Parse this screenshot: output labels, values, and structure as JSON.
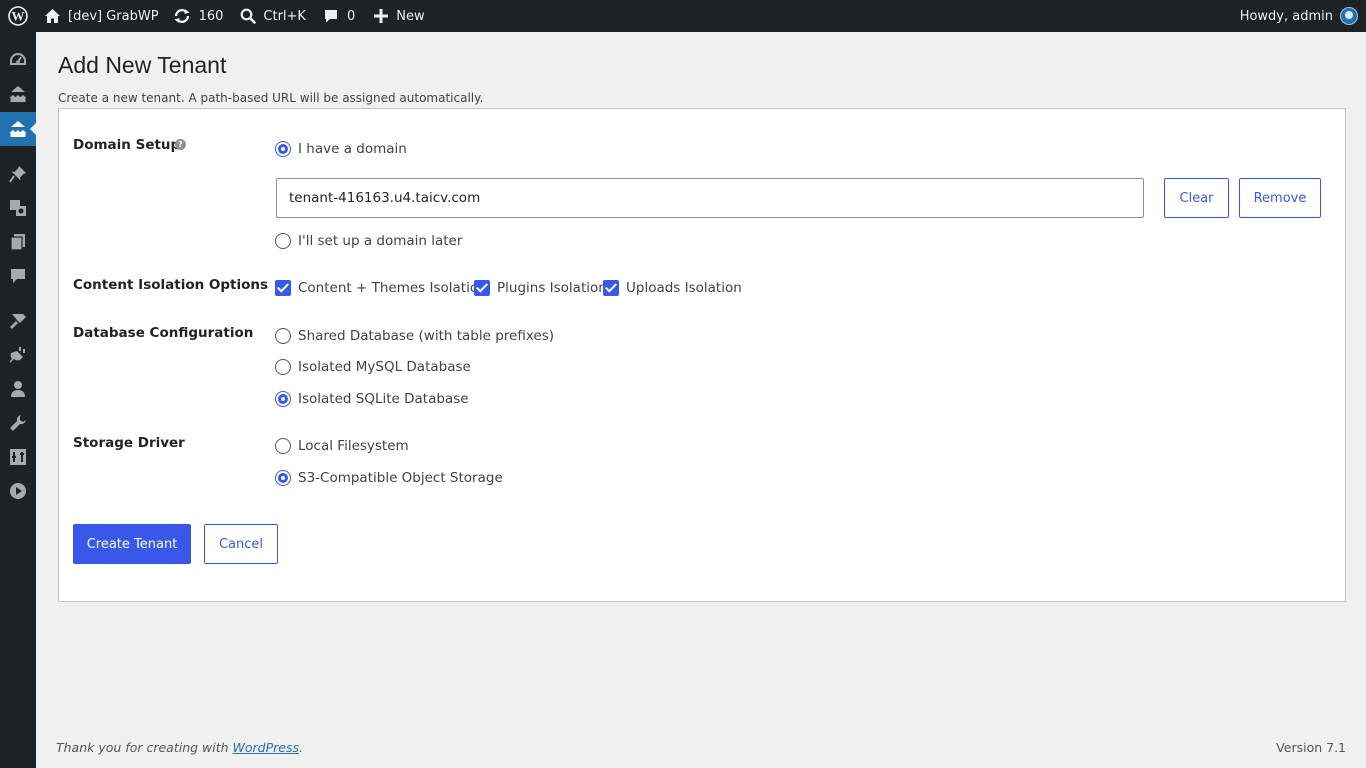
{
  "adminbar": {
    "site_name": "[dev] GrabWP",
    "updates_count": "160",
    "search_shortcut": "Ctrl+K",
    "comments_count": "0",
    "new_label": "New",
    "greeting": "Howdy, admin"
  },
  "sidebar": {
    "items": [
      {
        "icon": "dashboard-icon"
      },
      {
        "icon": "network-icon"
      },
      {
        "icon": "tenants-icon",
        "current": true
      },
      {
        "icon": "pin-icon"
      },
      {
        "icon": "media-icon"
      },
      {
        "icon": "pages-icon"
      },
      {
        "icon": "comments-icon"
      },
      {
        "icon": "appearance-icon"
      },
      {
        "icon": "plugins-icon"
      },
      {
        "icon": "users-icon"
      },
      {
        "icon": "tools-icon"
      },
      {
        "icon": "settings-icon"
      },
      {
        "icon": "play-icon"
      }
    ]
  },
  "page": {
    "title": "Add New Tenant",
    "description": "Create a new tenant. A path-based URL will be assigned automatically."
  },
  "form": {
    "domain_setup": {
      "label": "Domain Setup",
      "help_glyph": "?",
      "option_have": "I have a domain",
      "option_later": "I'll set up a domain later",
      "domain_value": "tenant-416163.u4.taicv.com",
      "clear_label": "Clear",
      "remove_label": "Remove",
      "selected": "have"
    },
    "content_isolation": {
      "label": "Content Isolation Options",
      "options": [
        "Content + Themes Isolation",
        "Plugins Isolation",
        "Uploads Isolation"
      ]
    },
    "database": {
      "label": "Database Configuration",
      "options": [
        "Shared Database (with table prefixes)",
        "Isolated MySQL Database",
        "Isolated SQLite Database"
      ],
      "selected": "Isolated SQLite Database"
    },
    "storage": {
      "label": "Storage Driver",
      "options": [
        "Local Filesystem",
        "S3-Compatible Object Storage"
      ],
      "selected": "S3-Compatible Object Storage"
    },
    "create_label": "Create Tenant",
    "cancel_label": "Cancel"
  },
  "footer": {
    "thanks_prefix": "Thank you for creating with ",
    "thanks_link": "WordPress",
    "thanks_suffix": ".",
    "version": "Version 7.1"
  },
  "colors": {
    "admin_bar": "#1d2327",
    "accent": "#3858e9",
    "menu_current": "#2271b1",
    "page_bg": "#f0f0f1"
  }
}
